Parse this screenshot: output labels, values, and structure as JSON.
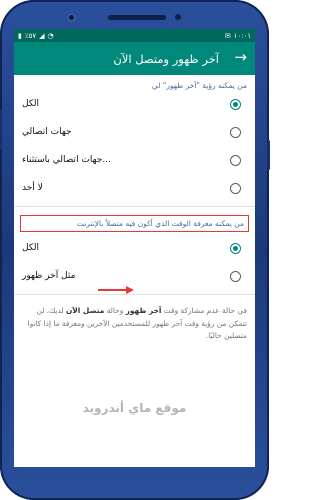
{
  "status_bar": {
    "time": "١٠:٠١",
    "battery": "٪٥٧"
  },
  "app_bar": {
    "title": "آخر ظهور ومتصل الآن"
  },
  "last_seen": {
    "heading": "من يمكنه رؤية \"آخر ظهور\" لي",
    "options": [
      {
        "label": "الكل",
        "selected": true
      },
      {
        "label": "جهات اتصالي",
        "selected": false
      },
      {
        "label": "جهات اتصالي باستثناء...",
        "selected": false
      },
      {
        "label": "لا أحد",
        "selected": false
      }
    ]
  },
  "online": {
    "heading": "من يمكنه معرفة الوقت الذي أكون فيه متصلاً بالإنترنت",
    "options": [
      {
        "label": "الكل",
        "selected": true
      },
      {
        "label": "مثل آخر ظهور",
        "selected": false
      }
    ]
  },
  "info": {
    "part1": "في حالة عدم مشاركة وقت ",
    "bold1": "آخر ظهور",
    "part2": " وحالة ",
    "bold2": "متصل الآن",
    "part3": " لديك، لن تتمكن من رؤية وقت آخر ظهور للمستخدمين الآخرين ومعرفة ما إذا كانوا متصلين حاليًا."
  },
  "watermark": "موقع ماي أندرويد",
  "colors": {
    "accent": "#00897b",
    "status_bar": "#00695c",
    "highlight": "#e53935",
    "phone_frame": "#2a4f9c"
  }
}
